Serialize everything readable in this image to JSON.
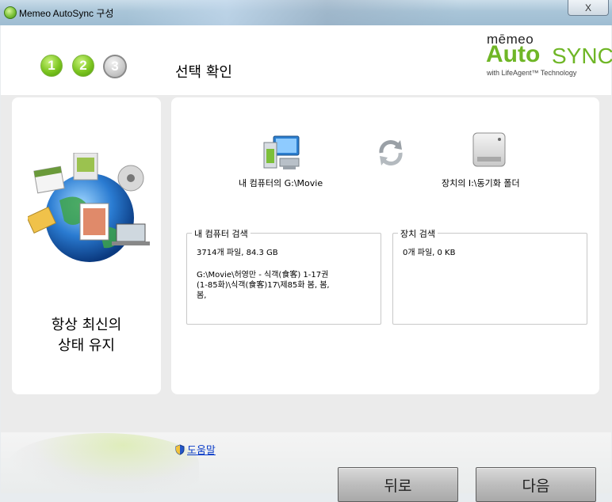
{
  "window": {
    "title": "Memeo AutoSync 구성",
    "close_label": "X"
  },
  "steps": [
    {
      "label": "1",
      "state": "done"
    },
    {
      "label": "2",
      "state": "done"
    },
    {
      "label": "3",
      "state": "current"
    }
  ],
  "page_title": "선택 확인",
  "logo": {
    "brand": "mēmeo",
    "auto": "Auto",
    "sync": "SYNC",
    "tagline": "with LifeAgent™ Technology",
    "color": "#6fb626"
  },
  "left_panel": {
    "text_line1": "항상 최신의",
    "text_line2": "상태 유지"
  },
  "source": {
    "label": "내 컴퓨터의 G:\\Movie",
    "icon": "computer-icon"
  },
  "destination": {
    "label": "장치의 I:\\동기화 폴더",
    "icon": "drive-icon"
  },
  "sync_icon": "sync-arrows-icon",
  "source_scan": {
    "title": "내 컴퓨터 검색",
    "summary": "3714개 파일, 84.3 GB",
    "path_line1": "G:\\Movie\\허영만 - 식객(食客) 1-17권",
    "path_line2": "(1-85화)\\식객(食客)17\\제85화 봄, 봄,",
    "path_line3": "봄,"
  },
  "device_scan": {
    "title": "장치 검색",
    "summary": "0개 파일, 0 KB"
  },
  "help_link": "도움말",
  "buttons": {
    "back": "뒤로",
    "next": "다음"
  }
}
